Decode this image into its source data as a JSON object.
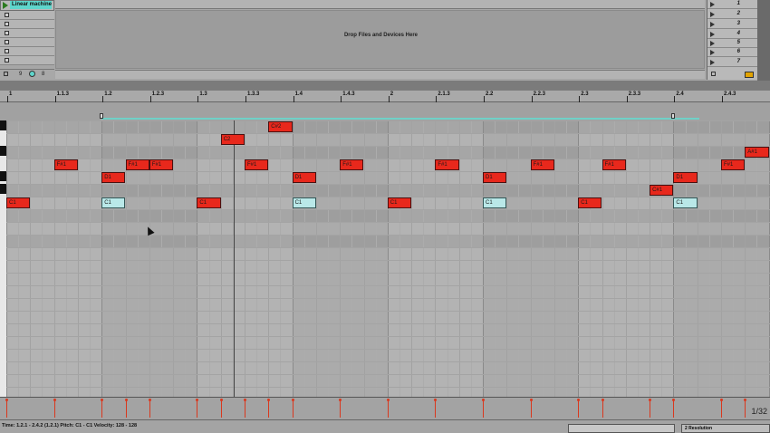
{
  "session": {
    "track_name": "Linear machine",
    "drop_text": "Drop Files and Devices Here",
    "footer_left": "9",
    "footer_right": "8",
    "scenes": [
      "1",
      "2",
      "3",
      "4",
      "5",
      "6",
      "7"
    ]
  },
  "ruler": {
    "labels": [
      "1",
      "1.1.3",
      "1.2",
      "1.2.3",
      "1.3",
      "1.3.3",
      "1.4",
      "1.4.3",
      "2",
      "2.1.3",
      "2.2",
      "2.2.3",
      "2.3",
      "2.3.3",
      "2.4",
      "2.4.3"
    ]
  },
  "notes": [
    {
      "pitch": "C1",
      "beat": 0,
      "len": 1,
      "sel": false
    },
    {
      "pitch": "F#1",
      "beat": 2,
      "len": 1,
      "sel": false
    },
    {
      "pitch": "C1",
      "beat": 4,
      "len": 1,
      "sel": true
    },
    {
      "pitch": "D1",
      "beat": 4,
      "len": 1,
      "sel": false
    },
    {
      "pitch": "F#1",
      "beat": 5,
      "len": 1,
      "sel": false
    },
    {
      "pitch": "F#1",
      "beat": 6,
      "len": 1,
      "sel": false
    },
    {
      "pitch": "C1",
      "beat": 8,
      "len": 1,
      "sel": false
    },
    {
      "pitch": "C2",
      "beat": 9,
      "len": 1,
      "sel": false
    },
    {
      "pitch": "F#1",
      "beat": 10,
      "len": 1,
      "sel": false
    },
    {
      "pitch": "C#2",
      "beat": 11,
      "len": 1,
      "sel": false
    },
    {
      "pitch": "C1",
      "beat": 12,
      "len": 1,
      "sel": true
    },
    {
      "pitch": "D1",
      "beat": 12,
      "len": 1,
      "sel": false
    },
    {
      "pitch": "F#1",
      "beat": 14,
      "len": 1,
      "sel": false
    },
    {
      "pitch": "C1",
      "beat": 16,
      "len": 1,
      "sel": false
    },
    {
      "pitch": "F#1",
      "beat": 18,
      "len": 1,
      "sel": false
    },
    {
      "pitch": "C1",
      "beat": 20,
      "len": 1,
      "sel": true
    },
    {
      "pitch": "D1",
      "beat": 20,
      "len": 1,
      "sel": false
    },
    {
      "pitch": "F#1",
      "beat": 22,
      "len": 1,
      "sel": false
    },
    {
      "pitch": "C1",
      "beat": 24,
      "len": 1,
      "sel": false
    },
    {
      "pitch": "F#1",
      "beat": 25,
      "len": 1,
      "sel": false
    },
    {
      "pitch": "C#1",
      "beat": 27,
      "len": 1,
      "sel": false
    },
    {
      "pitch": "C1",
      "beat": 28,
      "len": 1,
      "sel": true
    },
    {
      "pitch": "D1",
      "beat": 28,
      "len": 1,
      "sel": false
    },
    {
      "pitch": "F#1",
      "beat": 30,
      "len": 1,
      "sel": false
    },
    {
      "pitch": "A#1",
      "beat": 31,
      "len": 1,
      "sel": false
    }
  ],
  "velocity": {
    "grid_resolution": "1/32"
  },
  "status": {
    "text": "Time: 1.2.1 - 2.4.2 (1.2.1)   Pitch: C1 - C1   Velocity: 128 - 128",
    "box_right": "2 Resolution"
  },
  "colors": {
    "note": "#e8281c",
    "note_selected": "#b9e8e8",
    "loop": "#6fd1c8",
    "track_name": "#5fd6cc"
  }
}
